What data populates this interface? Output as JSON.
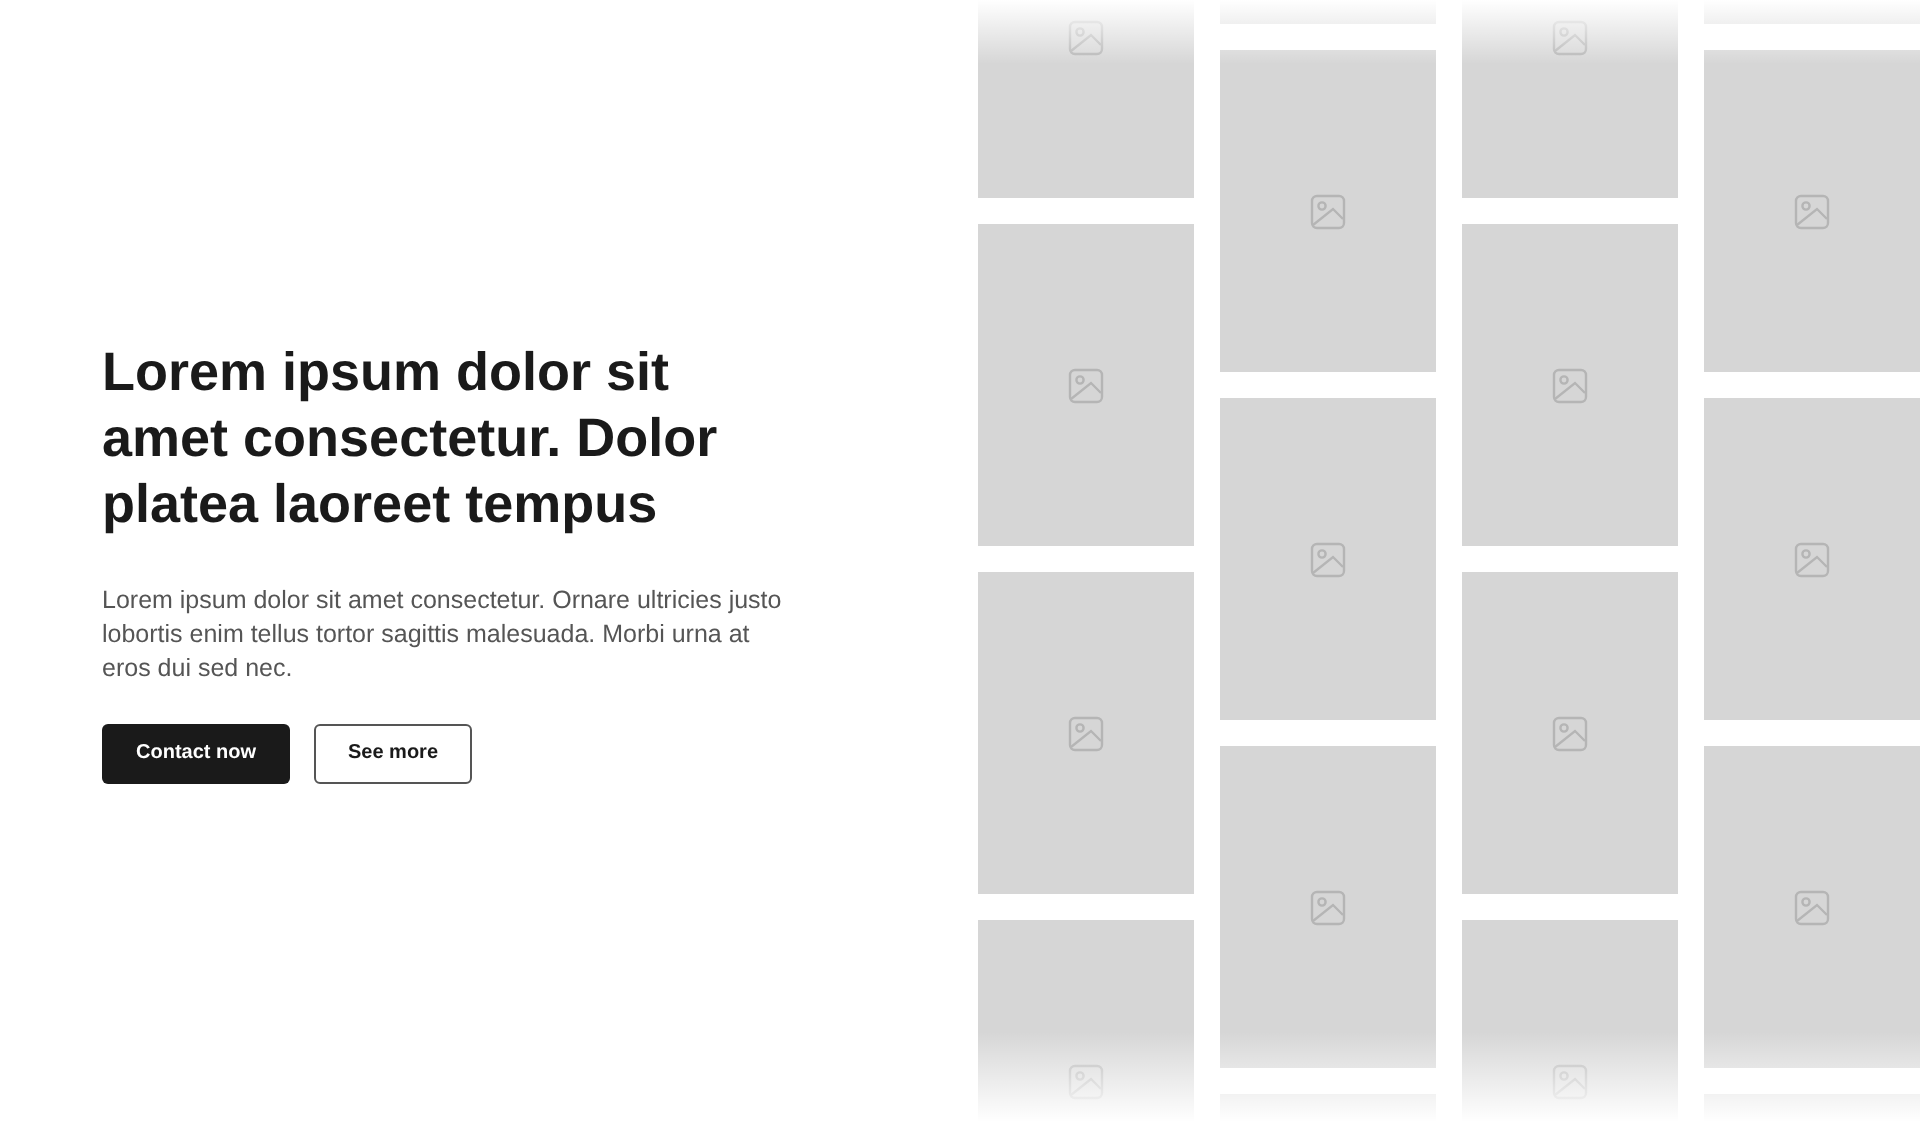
{
  "hero": {
    "heading": "Lorem ipsum dolor sit amet consectetur. Dolor platea laoreet tempus",
    "body": "Lorem ipsum dolor sit amet consectetur. Ornare ultricies justo lobortis enim tellus tortor sagittis malesuada. Morbi urna at eros dui sed nec.",
    "buttons": [
      {
        "label": "Contact now",
        "kind": "primary"
      },
      {
        "label": "See more",
        "kind": "secondary"
      }
    ]
  }
}
